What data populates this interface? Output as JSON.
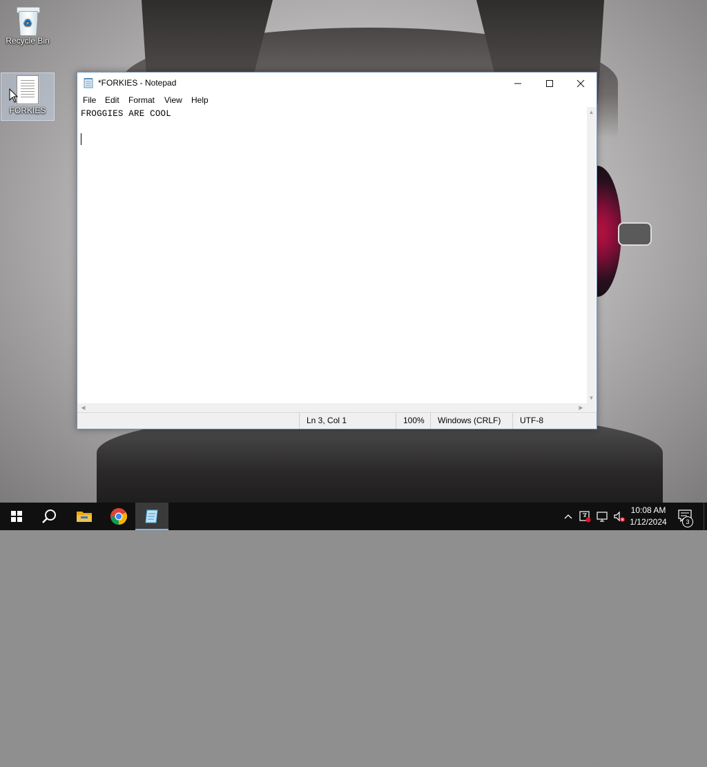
{
  "desktop": {
    "icons": [
      {
        "label": "Recycle Bin",
        "icon": "recycle-bin-icon"
      },
      {
        "label": "FORKIES",
        "icon": "text-file-icon"
      }
    ]
  },
  "notepad": {
    "title": "*FORKIES - Notepad",
    "menu": [
      "File",
      "Edit",
      "Format",
      "View",
      "Help"
    ],
    "content": "FROGGIES ARE COOL",
    "status": {
      "position": "Ln 3, Col 1",
      "zoom": "100%",
      "line_ending": "Windows (CRLF)",
      "encoding": "UTF-8"
    },
    "window_buttons": {
      "minimize": "—",
      "maximize": "☐",
      "close": "✕"
    }
  },
  "taskbar": {
    "apps": [
      "start-icon",
      "search-icon",
      "file-explorer-icon",
      "chrome-icon",
      "notepad-icon"
    ],
    "clock_time": "10:08 AM",
    "clock_date": "1/12/2024",
    "notification_count": "3"
  },
  "colors": {
    "taskbar": "#101010",
    "active_indicator": "#76b9ed",
    "window_border": "#6e8fb3",
    "chrome_red": "#db4437",
    "chrome_green": "#0f9d58",
    "chrome_yellow": "#f4b400",
    "chrome_blue": "#4285f4",
    "folder_yellow": "#f0c14b"
  }
}
